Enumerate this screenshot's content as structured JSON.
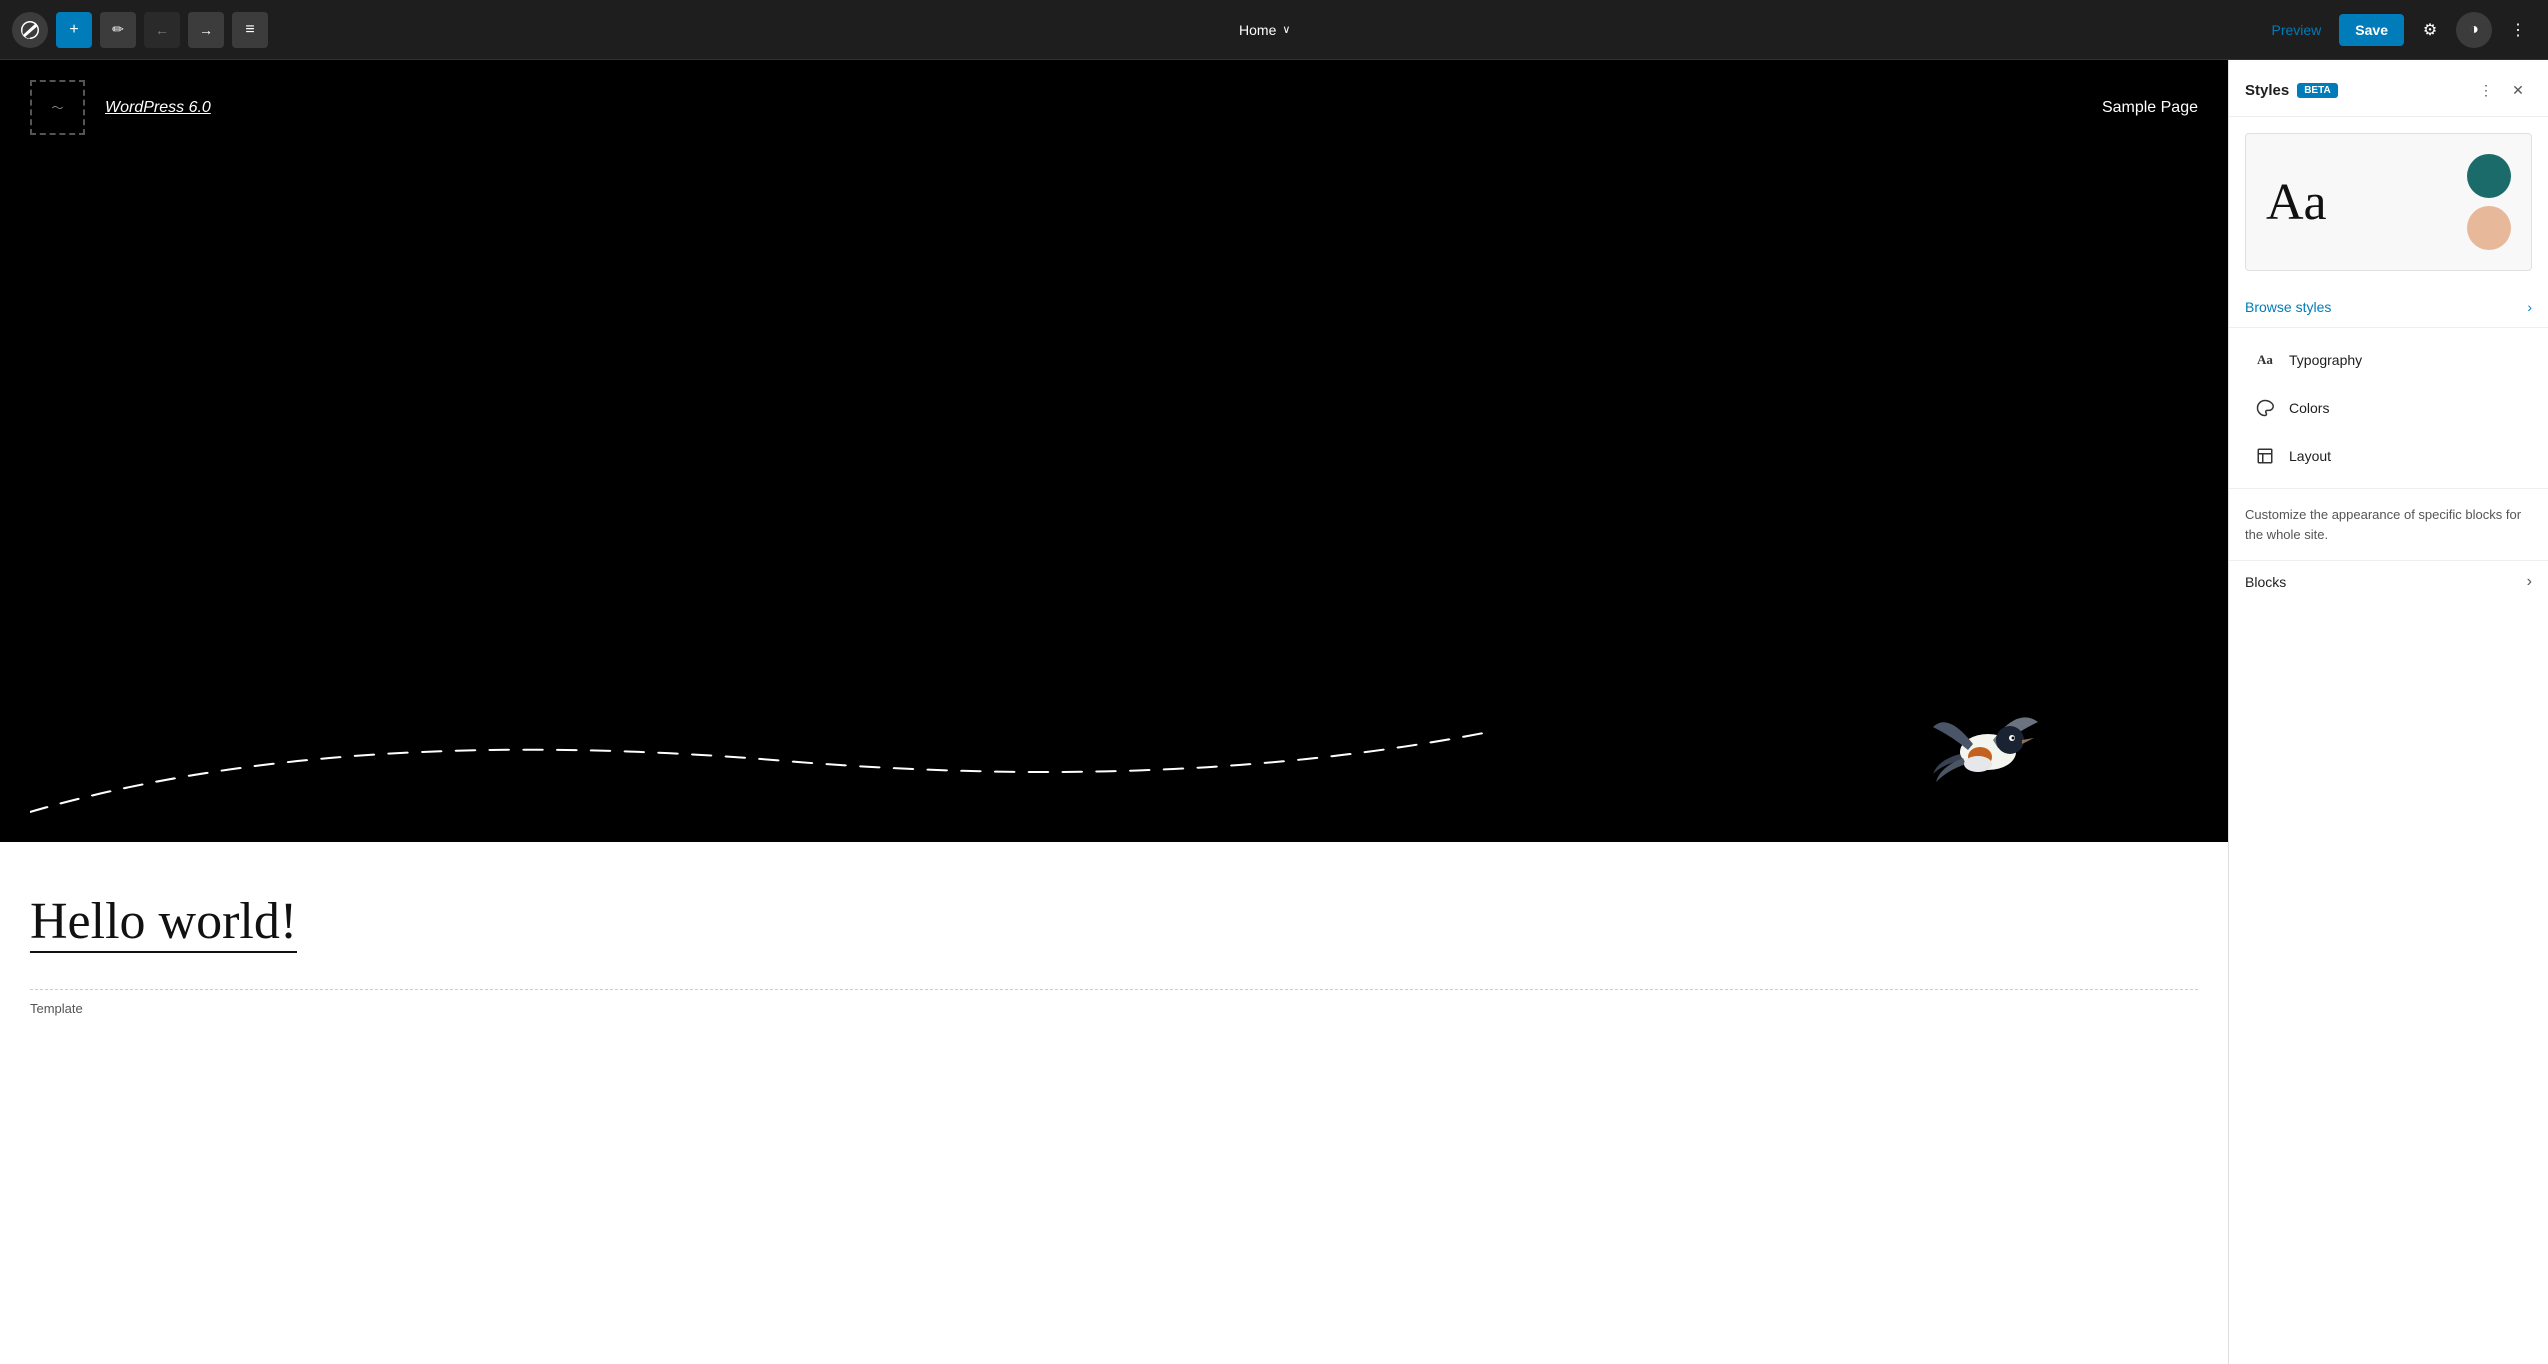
{
  "topbar": {
    "add_label": "+",
    "edit_icon": "✏",
    "undo_icon": "←",
    "redo_icon": "→",
    "list_icon": "≡",
    "page_name": "Home",
    "chevron_down": "∨",
    "preview_label": "Preview",
    "save_label": "Save",
    "settings_icon": "⚙",
    "dark_mode_icon": "◑",
    "more_icon": "⋮"
  },
  "canvas": {
    "site_title": "WordPress 6.0",
    "nav_item": "Sample Page",
    "hero_text": "",
    "hello_world": "Hello world!",
    "template_label": "Template"
  },
  "sidebar": {
    "title": "Styles",
    "beta_label": "Beta",
    "more_icon": "⋮",
    "close_icon": "✕",
    "preview_text": "Aa",
    "circle1_color": "#1a6b6a",
    "circle2_color": "#e8b89a",
    "browse_styles_label": "Browse styles",
    "chevron_right": "›",
    "menu_items": [
      {
        "id": "typography",
        "icon": "Aa",
        "label": "Typography"
      },
      {
        "id": "colors",
        "icon": "💧",
        "label": "Colors"
      },
      {
        "id": "layout",
        "icon": "⊞",
        "label": "Layout"
      }
    ],
    "description": "Customize the appearance of specific blocks for the whole site.",
    "blocks_label": "Blocks",
    "blocks_chevron": "›"
  }
}
